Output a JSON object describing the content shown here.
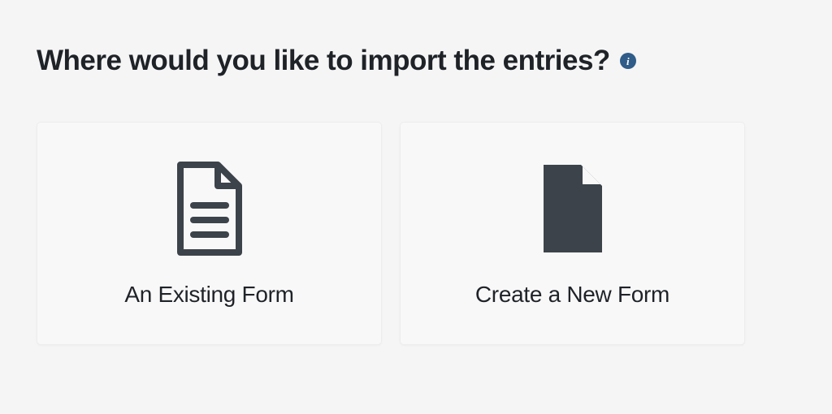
{
  "heading": "Where would you like to import the entries?",
  "options": [
    {
      "label": "An Existing Form"
    },
    {
      "label": "Create a New Form"
    }
  ],
  "colors": {
    "iconDark": "#3c434a",
    "infoBlue": "#2f5c89"
  }
}
